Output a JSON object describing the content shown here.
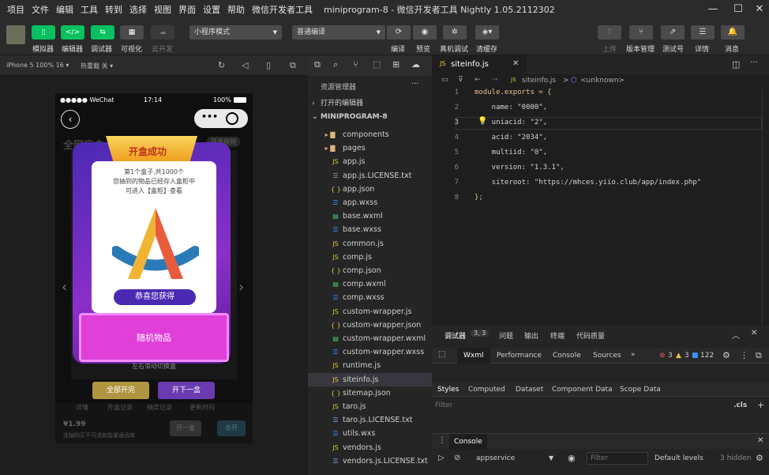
{
  "menu": [
    "项目",
    "文件",
    "编辑",
    "工具",
    "转到",
    "选择",
    "视图",
    "界面",
    "设置",
    "帮助",
    "微信开发者工具"
  ],
  "window_title": "miniprogram-8 - 微信开发者工具 Nightly 1.05.2112302",
  "toolbar": {
    "left_buttons": [
      "模拟器",
      "编辑器",
      "调试器",
      "可视化",
      "云开发"
    ],
    "mode_select": "小程序模式",
    "compile_select": "普通编译",
    "mid_buttons": [
      "编译",
      "预览",
      "真机调试",
      "清缓存"
    ],
    "right_buttons": [
      "上传",
      "版本管理",
      "测试号",
      "详情",
      "消息"
    ]
  },
  "simulator": {
    "device": "iPhone 5 100% 16",
    "hot_reload": "热重载 关",
    "status": {
      "carrier": "●●●●● WeChat",
      "time": "17:14",
      "battery": "100%"
    },
    "popup": {
      "title": "开盒成功",
      "line1": "第1个盒子,共1000个",
      "line2": "您抽到的物品已经存入盒柜中",
      "line3": "可进入【盒柜】查看",
      "pill": "恭喜您获得",
      "item_label": "随机物品"
    },
    "bg": {
      "header": "全网盲盒",
      "tag": "开盒规则",
      "hint": "左右滑动切换盒",
      "btn_open_all": "全部开完",
      "btn_next": "开下一盒",
      "price": "¥1.99",
      "small": "连抽购买不可退款能量通函库",
      "tabs": [
        "详情",
        "开盒记录",
        "抽奖记录",
        "更新时间"
      ],
      "bottom_btn1": "开一盒",
      "bottom_btn2": "去开"
    }
  },
  "explorer": {
    "title": "资源管理器",
    "open_editors": "打开的编辑器",
    "project": "MINIPROGRAM-8",
    "files": [
      {
        "name": "components",
        "type": "folder"
      },
      {
        "name": "pages",
        "type": "folder"
      },
      {
        "name": "app.js",
        "type": "js"
      },
      {
        "name": "app.js.LICENSE.txt",
        "type": "txt"
      },
      {
        "name": "app.json",
        "type": "json"
      },
      {
        "name": "app.wxss",
        "type": "wxss"
      },
      {
        "name": "base.wxml",
        "type": "wxml"
      },
      {
        "name": "base.wxss",
        "type": "wxss"
      },
      {
        "name": "common.js",
        "type": "js"
      },
      {
        "name": "comp.js",
        "type": "js"
      },
      {
        "name": "comp.json",
        "type": "json"
      },
      {
        "name": "comp.wxml",
        "type": "wxml"
      },
      {
        "name": "comp.wxss",
        "type": "wxss"
      },
      {
        "name": "custom-wrapper.js",
        "type": "js"
      },
      {
        "name": "custom-wrapper.json",
        "type": "json"
      },
      {
        "name": "custom-wrapper.wxml",
        "type": "wxml"
      },
      {
        "name": "custom-wrapper.wxss",
        "type": "wxss"
      },
      {
        "name": "runtime.js",
        "type": "js"
      },
      {
        "name": "siteinfo.js",
        "type": "js",
        "selected": true
      },
      {
        "name": "sitemap.json",
        "type": "json"
      },
      {
        "name": "taro.js",
        "type": "js"
      },
      {
        "name": "taro.js.LICENSE.txt",
        "type": "txt"
      },
      {
        "name": "utils.wxs",
        "type": "wxs"
      },
      {
        "name": "vendors.js",
        "type": "js"
      },
      {
        "name": "vendors.js.LICENSE.txt",
        "type": "txt"
      }
    ]
  },
  "editor": {
    "tab": "siteinfo.js",
    "breadcrumb_file": "siteinfo.js",
    "breadcrumb_sep": ">",
    "breadcrumb_unknown": "<unknown>",
    "lines": [
      {
        "n": "1",
        "code": "module.exports = {"
      },
      {
        "n": "2",
        "code": "    name: \"0000\","
      },
      {
        "n": "3",
        "code": "    uniacid: \"2\","
      },
      {
        "n": "4",
        "code": "    acid: \"2034\","
      },
      {
        "n": "5",
        "code": "    multiid: \"0\","
      },
      {
        "n": "6",
        "code": "    version: \"1.3.1\","
      },
      {
        "n": "7",
        "code": "    siteroot: \"https://mhces.yiio.club/app/index.php\""
      },
      {
        "n": "8",
        "code": "};"
      }
    ]
  },
  "devtools": {
    "top_tabs": [
      "调试器",
      "问题",
      "输出",
      "终端",
      "代码质量"
    ],
    "badge": "3, 3",
    "panel_tabs": [
      "Wxml",
      "Performance",
      "Console",
      "Sources"
    ],
    "errors": "3",
    "warnings": "3",
    "info": "122",
    "style_tabs": [
      "Styles",
      "Computed",
      "Dataset",
      "Component Data",
      "Scope Data"
    ],
    "filter_placeholder": "Filter",
    "cls": ".cls",
    "console_tab": "Console",
    "context": "appservice",
    "filter2": "Filter",
    "levels": "Default levels",
    "hidden": "3 hidden"
  },
  "colors": {
    "wechat_green": "#07c160",
    "popup_purple": "#8b2fc9",
    "accent_blue": "#3794ff"
  }
}
